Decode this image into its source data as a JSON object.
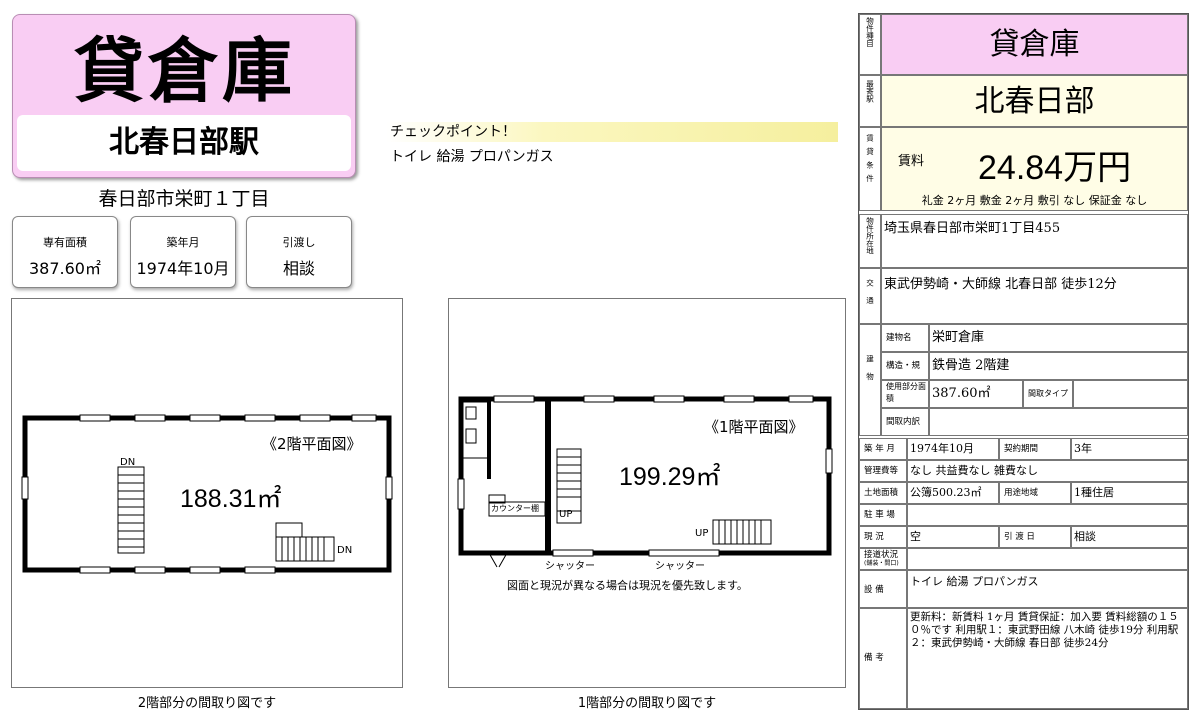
{
  "header": {
    "property_type": "貸倉庫",
    "station": "北春日部駅",
    "town": "春日部市栄町１丁目"
  },
  "stats": [
    {
      "label": "専有面積",
      "value": "387.60㎡"
    },
    {
      "label": "築年月",
      "value": "1974年10月"
    },
    {
      "label": "引渡し",
      "value": "相談"
    }
  ],
  "checkpoint": {
    "title": "チェックポイント！",
    "text": "トイレ 給湯 プロパンガス"
  },
  "plan2": {
    "title": "《2階平面図》",
    "area": "188.31㎡",
    "dn1": "DN",
    "dn2": "DN",
    "caption": "2階部分の間取り図です"
  },
  "plan1": {
    "title": "《1階平面図》",
    "area": "199.29㎡",
    "counter": "カウンター棚",
    "up1": "UP",
    "up2": "UP",
    "shutter1": "シャッター",
    "shutter2": "シャッター",
    "note": "図面と現況が異なる場合は現況を優先致します。",
    "caption": "1階部分の間取り図です"
  },
  "table": {
    "v_type": "物件種目",
    "type": "貸倉庫",
    "v_station": "最寄駅",
    "station": "北春日部",
    "v_terms": "賃貸条件",
    "rent_label": "賃料",
    "rent": "24.84万円",
    "terms_detail": "礼金 2ヶ月  敷金 2ヶ月  敷引 なし  保証金 なし",
    "v_location": "物件所在地",
    "location": "埼玉県春日部市栄町1丁目455",
    "v_transport": "交通",
    "transport": "東武伊勢崎・大師線 北春日部 徒歩12分",
    "v_building": "建物",
    "bname_label": "建物名",
    "bname": "栄町倉庫",
    "structure_label": "構造・規模",
    "structure": "鉄骨造 2階建",
    "usage_area_label": "使用部分面積",
    "usage_area": "387.60㎡",
    "layout_type_label": "間取タイプ",
    "layout_type": "",
    "layout_detail_label": "間取内訳",
    "layout_detail": "",
    "built_label": "築 年 月",
    "built": "1974年10月",
    "contract_label": "契約期間",
    "contract": "3年",
    "fee_label": "管理費等",
    "fee": "なし  共益費なし  雑費なし",
    "land_label": "土地面積",
    "land": "公簿500.23㎡",
    "zoning_label": "用途地域",
    "zoning": "1種住居",
    "parking_label": "駐 車 場",
    "parking": "",
    "status_label": "現   況",
    "status": "空",
    "handover_label": "引 渡 日",
    "handover": "相談",
    "road_label": "接道状況",
    "road_sub": "(舗装・間口)",
    "road": "",
    "facilities_label": "設   備",
    "facilities": "トイレ 給湯 プロパンガス",
    "remarks_label": "備   考",
    "remarks": "更新料：新賃料 1ヶ月   賃貸保証：加入要  賃料総額の１５０％です  利用駅１：東武野田線 八木崎 徒歩19分  利用駅２：東武伊勢崎・大師線 春日部 徒歩24分"
  }
}
